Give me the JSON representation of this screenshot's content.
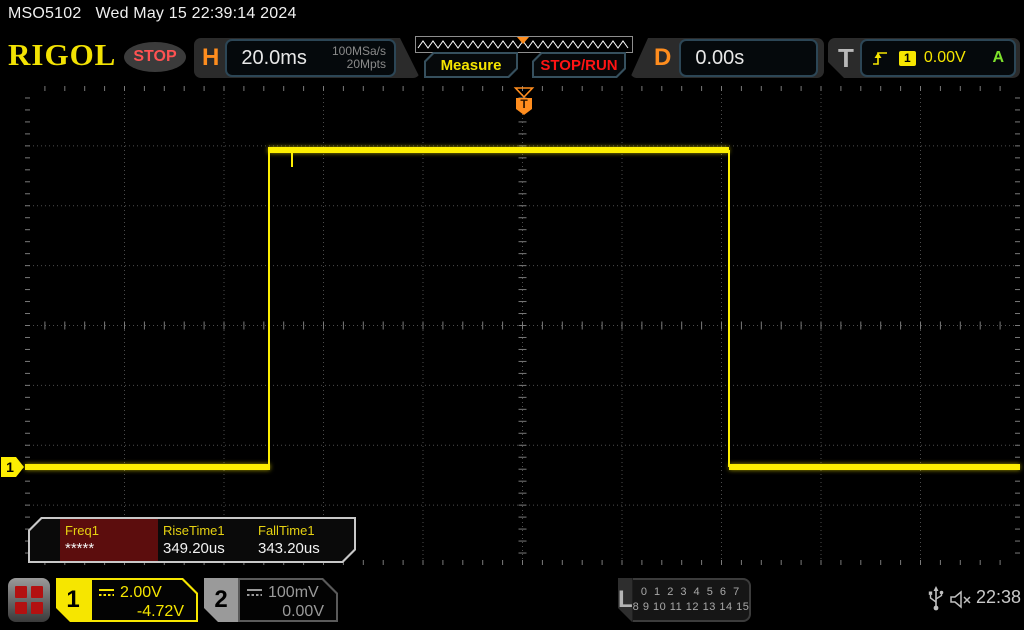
{
  "titlebar": {
    "model": "MSO5102",
    "datetime": "Wed May 15 22:39:14 2024"
  },
  "header": {
    "logo": "RIGOL",
    "run_state": "STOP",
    "horizontal": {
      "label": "H",
      "timebase": "20.0ms",
      "sample_rate": "100MSa/s",
      "memory_depth": "20Mpts"
    },
    "measure_label": "Measure",
    "stoprun_label": "STOP/RUN",
    "delay": {
      "label": "D",
      "value": "0.00s"
    },
    "trigger": {
      "label": "T",
      "source": "1",
      "level": "0.00V",
      "sweep": "A"
    }
  },
  "waveform": {
    "trigger_marker": "T",
    "ch1_marker": "1",
    "shape": "square pulse, CH1 yellow: low ~ -4.7V, high pulse from -2.5 div left of trigger to +2 div right"
  },
  "measurements": {
    "items": [
      {
        "name": "Freq1",
        "value": "*****"
      },
      {
        "name": "RiseTime1",
        "value": "349.20us"
      },
      {
        "name": "FallTime1",
        "value": "343.20us"
      }
    ]
  },
  "statusbar": {
    "ch1": {
      "number": "1",
      "scale": "2.00V",
      "offset": "-4.72V"
    },
    "ch2": {
      "number": "2",
      "scale": "100mV",
      "offset": "0.00V"
    },
    "logic": {
      "label": "L",
      "row1": "0 1 2 3 4 5 6 7",
      "row2": "8 9 10 11 12 13 14 15"
    },
    "clock": "22:38"
  },
  "colors": {
    "ch1_yellow": "#fdee02",
    "ch2_gray": "#9a9a9a",
    "accent_orange": "#ff8d1e",
    "stop_red": "#ff1414",
    "auto_green": "#7ee12c",
    "meas_highlight_red": "#5c0d0d"
  }
}
